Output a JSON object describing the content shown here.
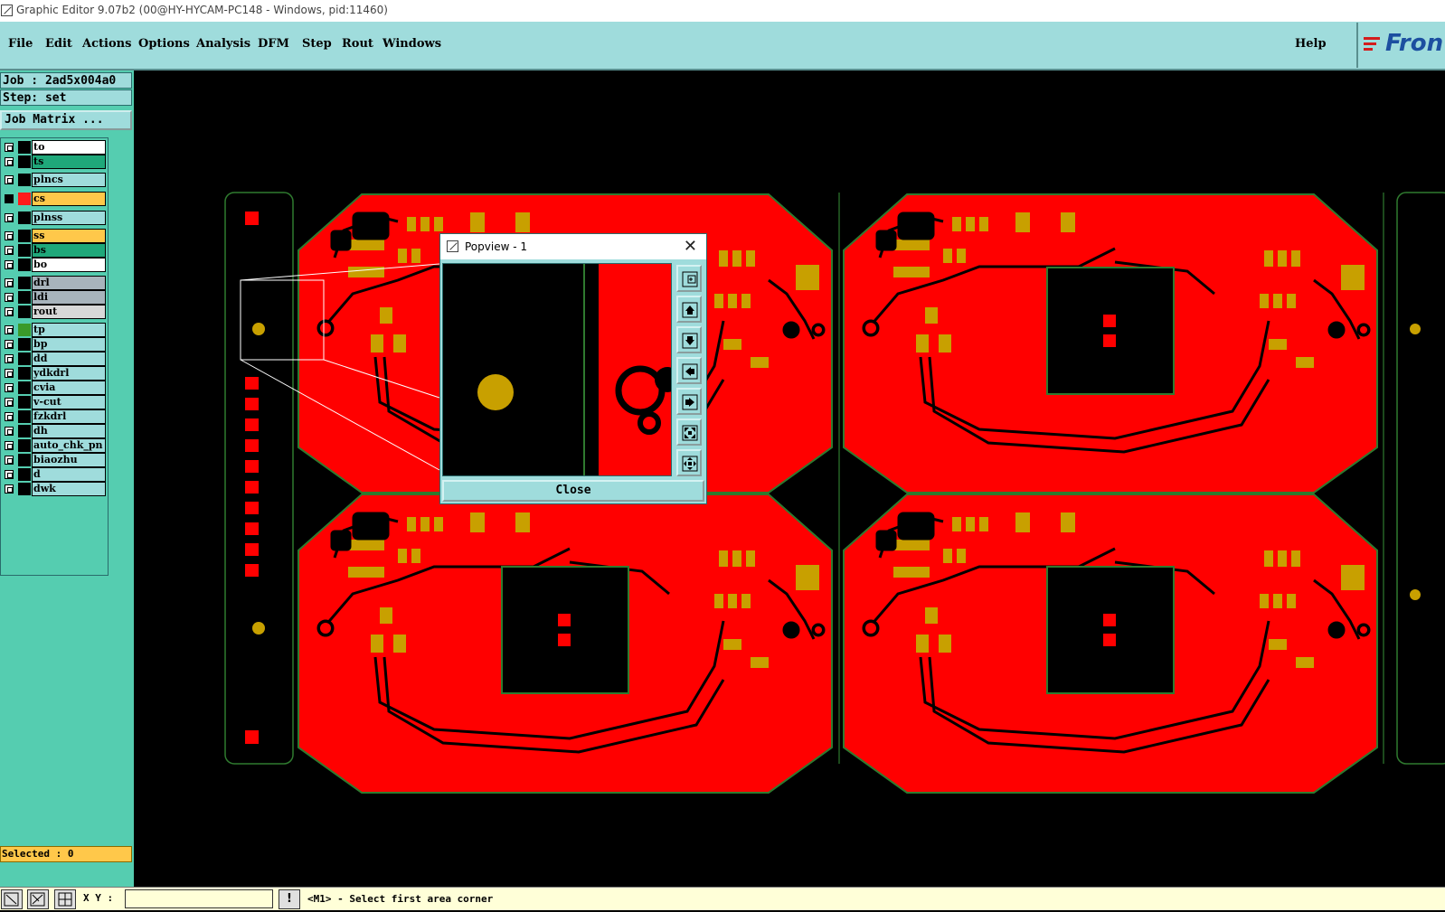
{
  "window": {
    "title": "Graphic Editor 9.07b2 (00@HY-HYCAM-PC148 - Windows, pid:11460)"
  },
  "menubar": {
    "items": [
      "File",
      "Edit",
      "Actions",
      "Options",
      "Analysis",
      "DFM",
      "Step",
      "Rout",
      "Windows"
    ],
    "help": "Help",
    "logo": "Fron"
  },
  "left_panel": {
    "job": "Job : 2ad5x004a0",
    "step": "Step: set",
    "job_matrix": "Job Matrix ...",
    "layers": [
      {
        "name": "to",
        "bg": "#ffffff",
        "swatch": "#000000",
        "checked": false
      },
      {
        "name": "ts",
        "bg": "#1fa87a",
        "swatch": "#000000",
        "checked": false
      },
      {
        "name": "plncs",
        "bg": "#9fdcdc",
        "swatch": "#000000",
        "checked": false
      },
      {
        "name": "cs",
        "bg": "#ffc84a",
        "swatch": "#ff1a1a",
        "checked": true
      },
      {
        "name": "plnss",
        "bg": "#9fdcdc",
        "swatch": "#000000",
        "checked": false
      },
      {
        "name": "ss",
        "bg": "#ffc84a",
        "swatch": "#000000",
        "checked": false
      },
      {
        "name": "bs",
        "bg": "#1fa87a",
        "swatch": "#000000",
        "checked": false
      },
      {
        "name": "bo",
        "bg": "#ffffff",
        "swatch": "#000000",
        "checked": false
      },
      {
        "name": "drl",
        "bg": "#a8b4bc",
        "swatch": "#000000",
        "checked": false
      },
      {
        "name": "ldi",
        "bg": "#a8b4bc",
        "swatch": "#000000",
        "checked": false
      },
      {
        "name": "rout",
        "bg": "#d8d8d8",
        "swatch": "#000000",
        "checked": false
      },
      {
        "name": "tp",
        "bg": "#9fdcdc",
        "swatch": "#3a9a2a",
        "checked": false
      },
      {
        "name": "bp",
        "bg": "#9fdcdc",
        "swatch": "#000000",
        "checked": false
      },
      {
        "name": "dd",
        "bg": "#9fdcdc",
        "swatch": "#000000",
        "checked": false
      },
      {
        "name": "ydkdrl",
        "bg": "#9fdcdc",
        "swatch": "#000000",
        "checked": false
      },
      {
        "name": "cvia",
        "bg": "#9fdcdc",
        "swatch": "#000000",
        "checked": false
      },
      {
        "name": "v-cut",
        "bg": "#9fdcdc",
        "swatch": "#000000",
        "checked": false
      },
      {
        "name": "fzkdrl",
        "bg": "#9fdcdc",
        "swatch": "#000000",
        "checked": false
      },
      {
        "name": "dh",
        "bg": "#9fdcdc",
        "swatch": "#000000",
        "checked": false
      },
      {
        "name": "auto_chk_pn",
        "bg": "#9fdcdc",
        "swatch": "#000000",
        "checked": false
      },
      {
        "name": "biaozhu",
        "bg": "#9fdcdc",
        "swatch": "#000000",
        "checked": false
      },
      {
        "name": "d",
        "bg": "#9fdcdc",
        "swatch": "#000000",
        "checked": false
      },
      {
        "name": "dwk",
        "bg": "#9fdcdc",
        "swatch": "#000000",
        "checked": false
      }
    ],
    "selected": "Selected : 0"
  },
  "popview": {
    "title": "Popview - 1",
    "close_label": "Close",
    "tools": [
      "zoom-in-icon",
      "pan-up-icon",
      "pan-down-icon",
      "pan-left-icon",
      "pan-right-icon",
      "zoom-fit-icon",
      "zoom-home-icon"
    ]
  },
  "statusbar": {
    "xy_label": "X Y :",
    "xy_value": "",
    "warn": "!",
    "message": "<M1> - Select first area corner"
  },
  "colors": {
    "menu": "#9fdcdc",
    "panel": "#55cdb0",
    "copper": "#ff0000",
    "pad": "#c8a000",
    "outline": "#2f7a2f"
  }
}
